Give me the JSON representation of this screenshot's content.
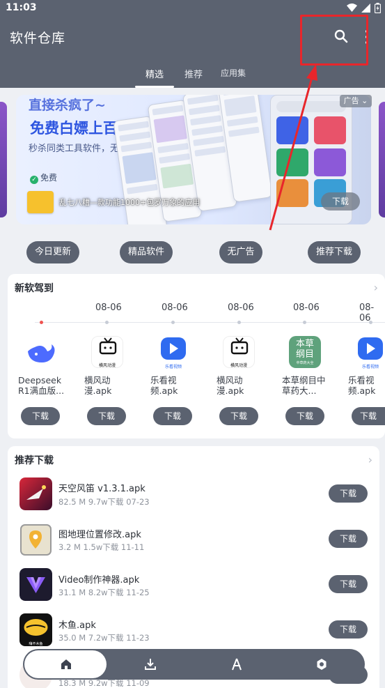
{
  "status_bar": {
    "time": "11:03",
    "icons": [
      "wifi-icon",
      "signal-icon",
      "battery-icon"
    ]
  },
  "app_bar": {
    "title": "软件仓库",
    "actions": [
      "search-icon",
      "more-icon"
    ]
  },
  "tabs": [
    {
      "label": "精选",
      "active": true
    },
    {
      "label": "推荐",
      "active": false
    },
    {
      "label": "应用集",
      "active": false
    }
  ],
  "banner": {
    "headline_top": "直接杀疯了~",
    "headline": "免费白嫖上百款付费功能",
    "subline": "秒杀同类工具软件，无广无限制",
    "check_1": "免费",
    "check_2": "",
    "ad_label": "广告",
    "caption": "乱七八糟—款功能1000+包罗万象的应用",
    "download_label": "下载"
  },
  "quick_links": [
    "今日更新",
    "精品软件",
    "无广告",
    "推荐下载"
  ],
  "new_section": {
    "title": "新软驾到",
    "items": [
      {
        "date": "",
        "name": "Deepseek R1满血版...",
        "download": "下载"
      },
      {
        "date": "08-06",
        "name": "横风动漫.apk",
        "download": "下载"
      },
      {
        "date": "08-06",
        "name": "乐看视频.apk",
        "download": "下载"
      },
      {
        "date": "08-06",
        "name": "横风动漫.apk",
        "download": "下载"
      },
      {
        "date": "08-06",
        "name": "本草纲目中草药大...",
        "download": "下载"
      },
      {
        "date": "08-06",
        "name": "乐看视频.apk",
        "download": "下载"
      }
    ],
    "icon_texts": {
      "tv_caption": "横风动漫",
      "lk_caption": "乐看视频",
      "bc_big": "本草纲目",
      "bc_small": "中草药大全"
    }
  },
  "recommend_section": {
    "title": "推荐下载",
    "items": [
      {
        "name": "天空风笛 v1.3.1.apk",
        "size": "82.5 M",
        "downloads": "9.7w下载",
        "date": "07-23",
        "download": "下载"
      },
      {
        "name": "图地理位置修改.apk",
        "size": "3.2 M",
        "downloads": "1.5w下载",
        "date": "11-11",
        "download": "下载"
      },
      {
        "name": "Video制作神器.apk",
        "size": "31.1 M",
        "downloads": "8.2w下载",
        "date": "11-25",
        "download": "下载"
      },
      {
        "name": "木鱼.apk",
        "size": "35.0 M",
        "downloads": "7.2w下载",
        "date": "11-23",
        "download": "下载"
      },
      {
        "name": "",
        "size": "18.3 M",
        "downloads": "9.2w下载",
        "date": "11-09",
        "download": "下载"
      }
    ],
    "muyu_caption": "嗨不木鱼"
  },
  "bottom_nav": [
    "home-icon",
    "download-icon",
    "app-store-icon",
    "settings-icon"
  ],
  "colors": {
    "primary": "#5b6270",
    "highlight": "#e8262b",
    "banner_blue": "#2d55e0",
    "background": "#eef0f4"
  }
}
